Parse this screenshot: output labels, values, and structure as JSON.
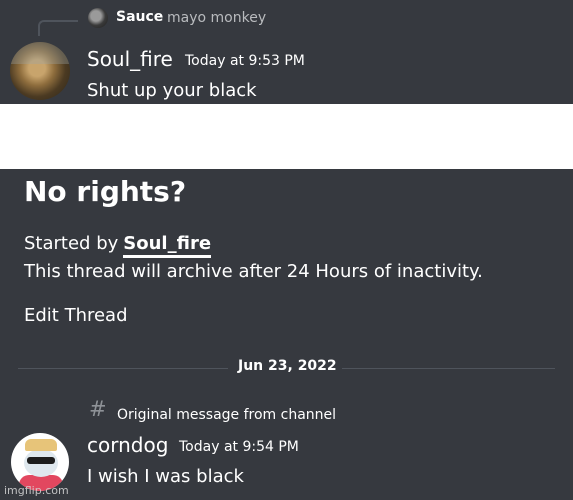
{
  "reply": {
    "author": "Sauce",
    "preview": "mayo monkey"
  },
  "message1": {
    "author": "Soul_fire",
    "timestamp": "Today at 9:53 PM",
    "text": "Shut up your black"
  },
  "thread": {
    "title": "No rights?",
    "started_by_label": "Started by",
    "started_by_user": "Soul_fire",
    "archive_note": "This thread will archive after 24 Hours of inactivity.",
    "edit_label": "Edit Thread"
  },
  "divider": {
    "date": "Jun 23, 2022"
  },
  "message2": {
    "channel_icon": "#",
    "original_label": "Original message from channel",
    "author": "corndog",
    "timestamp": "Today at 9:54 PM",
    "text": "I wish I was black"
  },
  "watermark": "imgflip.com",
  "colors": {
    "background": "#36393f",
    "divider": "#4f545c",
    "muted": "#8e9297",
    "text": "#ffffff"
  }
}
